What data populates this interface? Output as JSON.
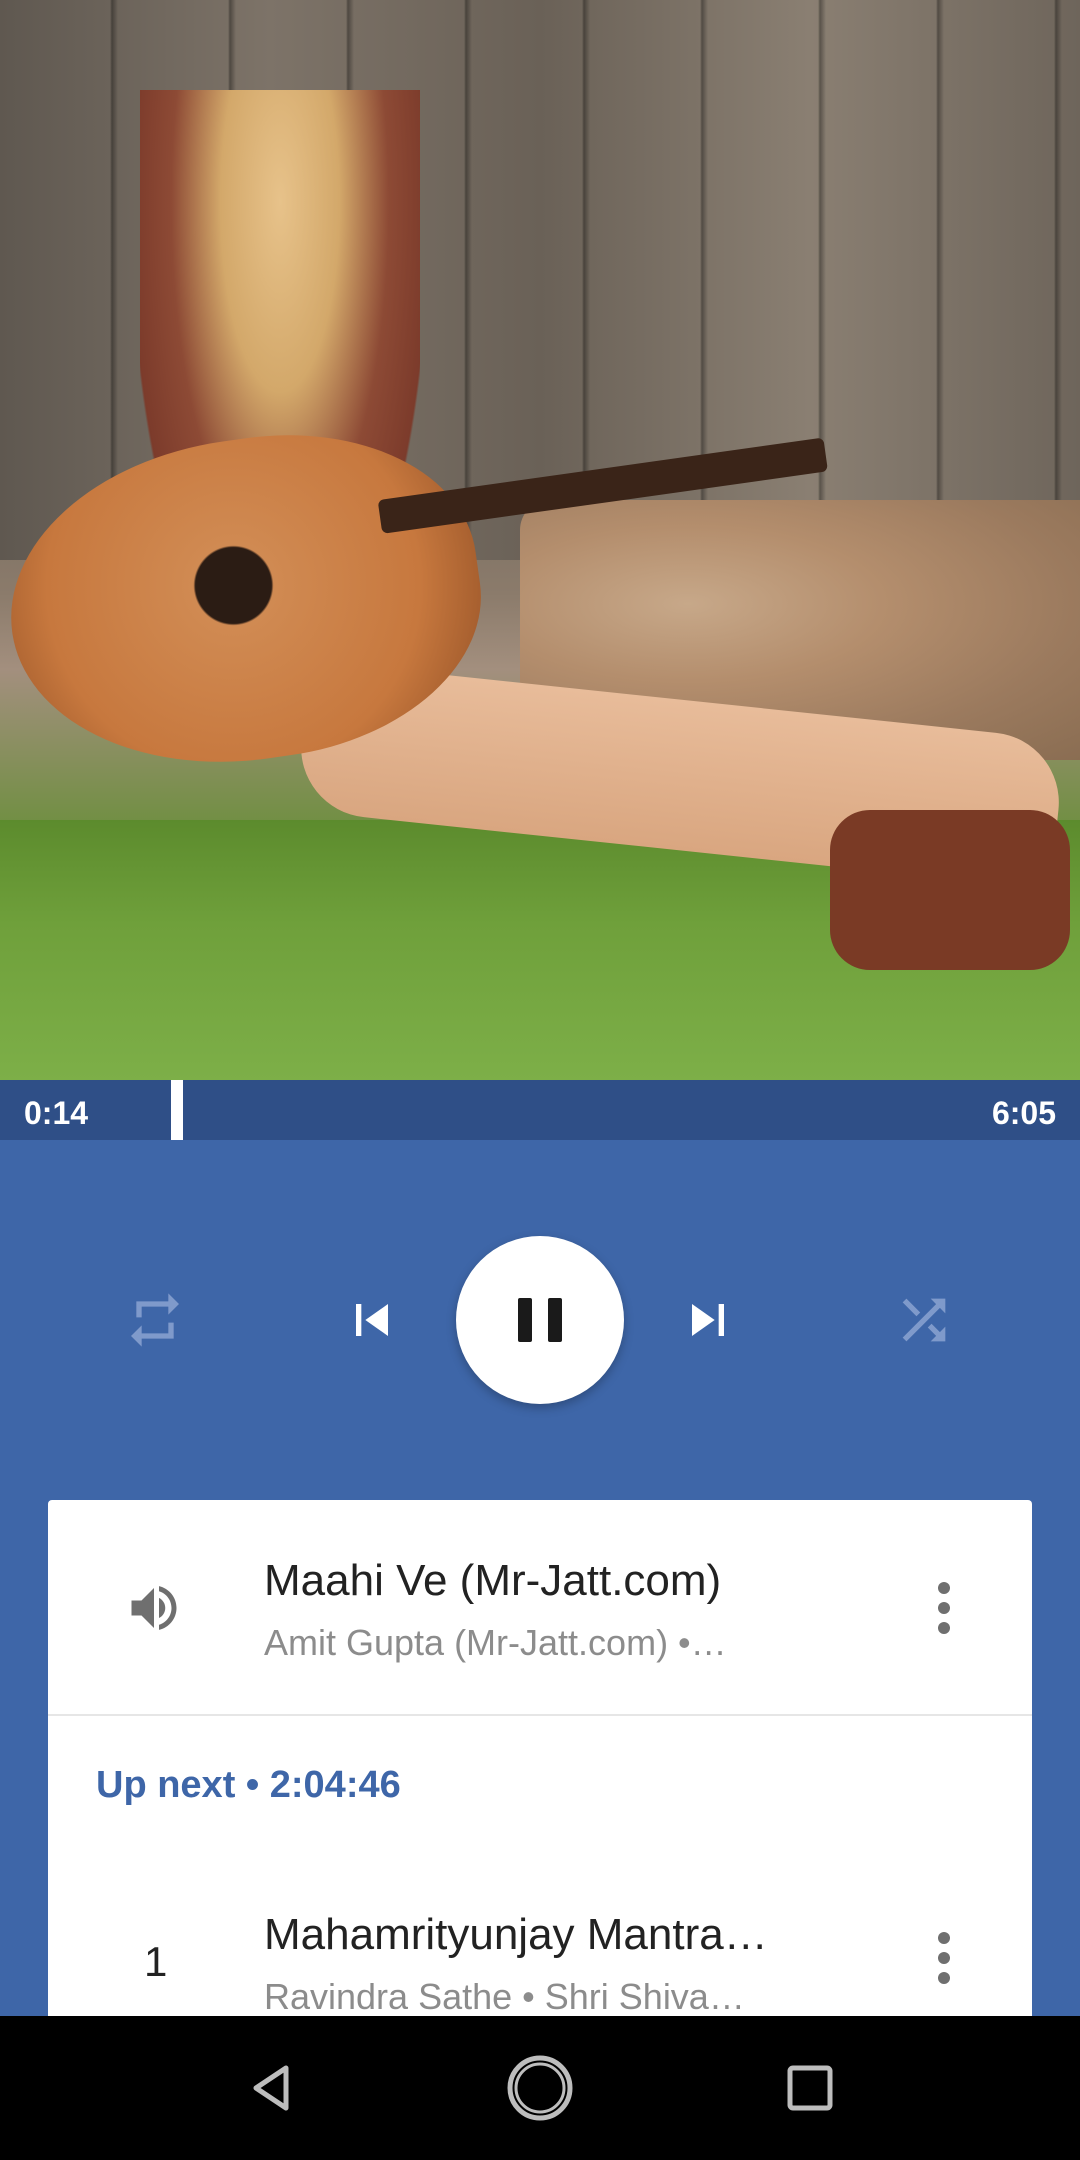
{
  "player": {
    "elapsed": "0:14",
    "duration": "6:05",
    "progress_fraction": 0.038
  },
  "controls": {
    "repeat": "repeat-icon",
    "previous": "skip-previous-icon",
    "play_pause": "pause-icon",
    "next": "skip-next-icon",
    "shuffle": "shuffle-icon"
  },
  "now_playing": {
    "title": "Maahi Ve (Mr-Jatt.com)",
    "subtitle": "Amit Gupta (Mr-Jatt.com)  •…"
  },
  "up_next": {
    "label": "Up next  •  2:04:46"
  },
  "queue": [
    {
      "number": "1",
      "title": "Mahamrityunjay Mantra…",
      "subtitle": "Ravindra Sathe  •  Shri Shiva…"
    }
  ],
  "colors": {
    "accent": "#3e66a8",
    "progress_track": "#2f4f87"
  }
}
